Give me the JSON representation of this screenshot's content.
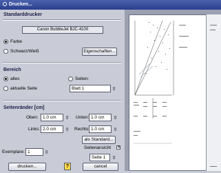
{
  "window": {
    "title": "Drucken..."
  },
  "printer": {
    "section_title": "Standarddrucker",
    "name": "Canon BubbleJet BJC-4100",
    "color_label": "Farbe",
    "bw_label": "Schwarz/Weiß",
    "color_selected": "color",
    "properties_button": "Eigenschaften..."
  },
  "range": {
    "section_title": "Bereich",
    "all_label": "alles",
    "pages_label": "Seiten:",
    "current_page_label": "aktuelle Seite",
    "sheet_value": "Blatt 1",
    "selected": "all"
  },
  "margins": {
    "section_title": "Seitenränder [cm]",
    "top_label": "Oben:",
    "top_value": "1.0 cm",
    "bottom_label": "Unten:",
    "bottom_value": "1.0 cm",
    "left_label": "Links:",
    "left_value": "2.0 cm",
    "right_label": "Rechts:",
    "right_value": "1.0 cm",
    "default_button": "als Standard..."
  },
  "copies": {
    "label": "Exemplare:",
    "value": "1"
  },
  "page_view": {
    "label": "Seitenansicht",
    "checked": true,
    "page_value": "Seite 1"
  },
  "footer": {
    "print_button": "drucken...",
    "cancel_button": "cancel",
    "help_icon": "help-icon"
  }
}
